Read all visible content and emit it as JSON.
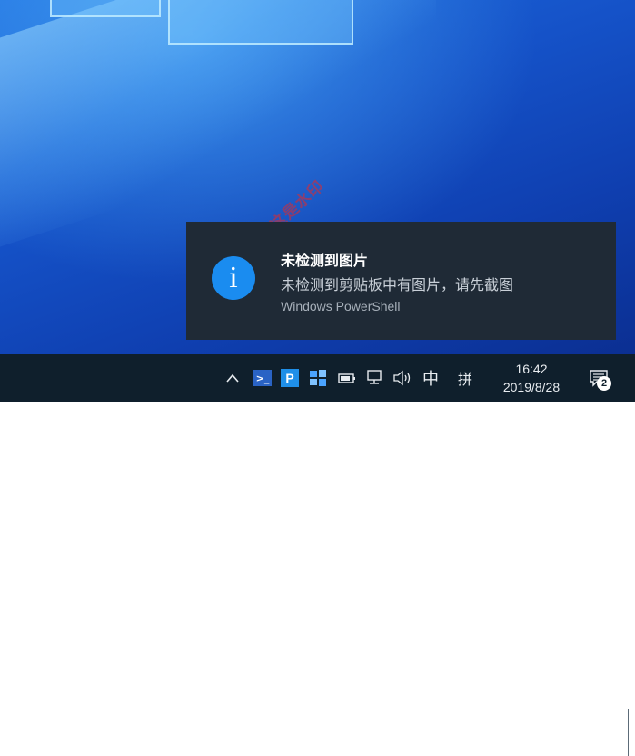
{
  "toast": {
    "title": "未检测到图片",
    "body": "未检测到剪贴板中有图片，请先截图",
    "source": "Windows PowerShell",
    "icon": "info-icon"
  },
  "watermark": "这是水印",
  "taskbar": {
    "tray": {
      "chevron": "^",
      "ime_mode": "中",
      "ime_layout": "拼",
      "time": "16:42",
      "date": "2019/8/28",
      "notification_count": "2"
    },
    "icons": [
      "chevron-up-icon",
      "powershell-icon",
      "p-app-icon",
      "windows-flag-icon",
      "battery-icon",
      "network-icon",
      "volume-icon",
      "notification-icon"
    ]
  },
  "colors": {
    "toast_bg": "#1f2a36",
    "info_accent": "#1a8cf0",
    "taskbar_bg": "#0f1f2c"
  }
}
